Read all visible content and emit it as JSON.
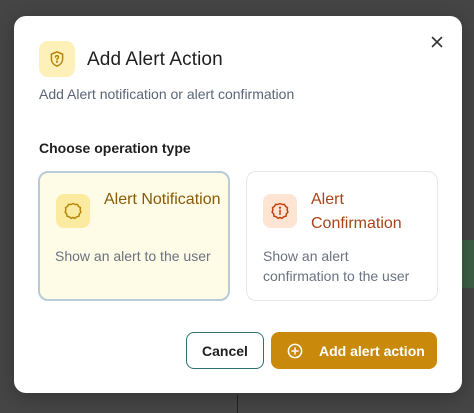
{
  "dialog": {
    "title": "Add Alert Action",
    "subtitle": "Add Alert notification or alert confirmation",
    "section_label": "Choose operation type",
    "icons": {
      "header": "shield-question-icon",
      "close": "close-icon"
    },
    "colors": {
      "accent": "#c98a0b",
      "selected_bg": "#fefbe6"
    }
  },
  "options": [
    {
      "title": "Alert Notification",
      "description": "Show an alert to the user",
      "icon": "octagon-icon",
      "selected": true
    },
    {
      "title": "Alert Confirmation",
      "description": "Show an alert confirmation to the user",
      "icon": "alert-info-icon",
      "selected": false
    }
  ],
  "footer": {
    "cancel_label": "Cancel",
    "submit_label": "Add alert action",
    "submit_icon": "plus-circle-icon"
  }
}
